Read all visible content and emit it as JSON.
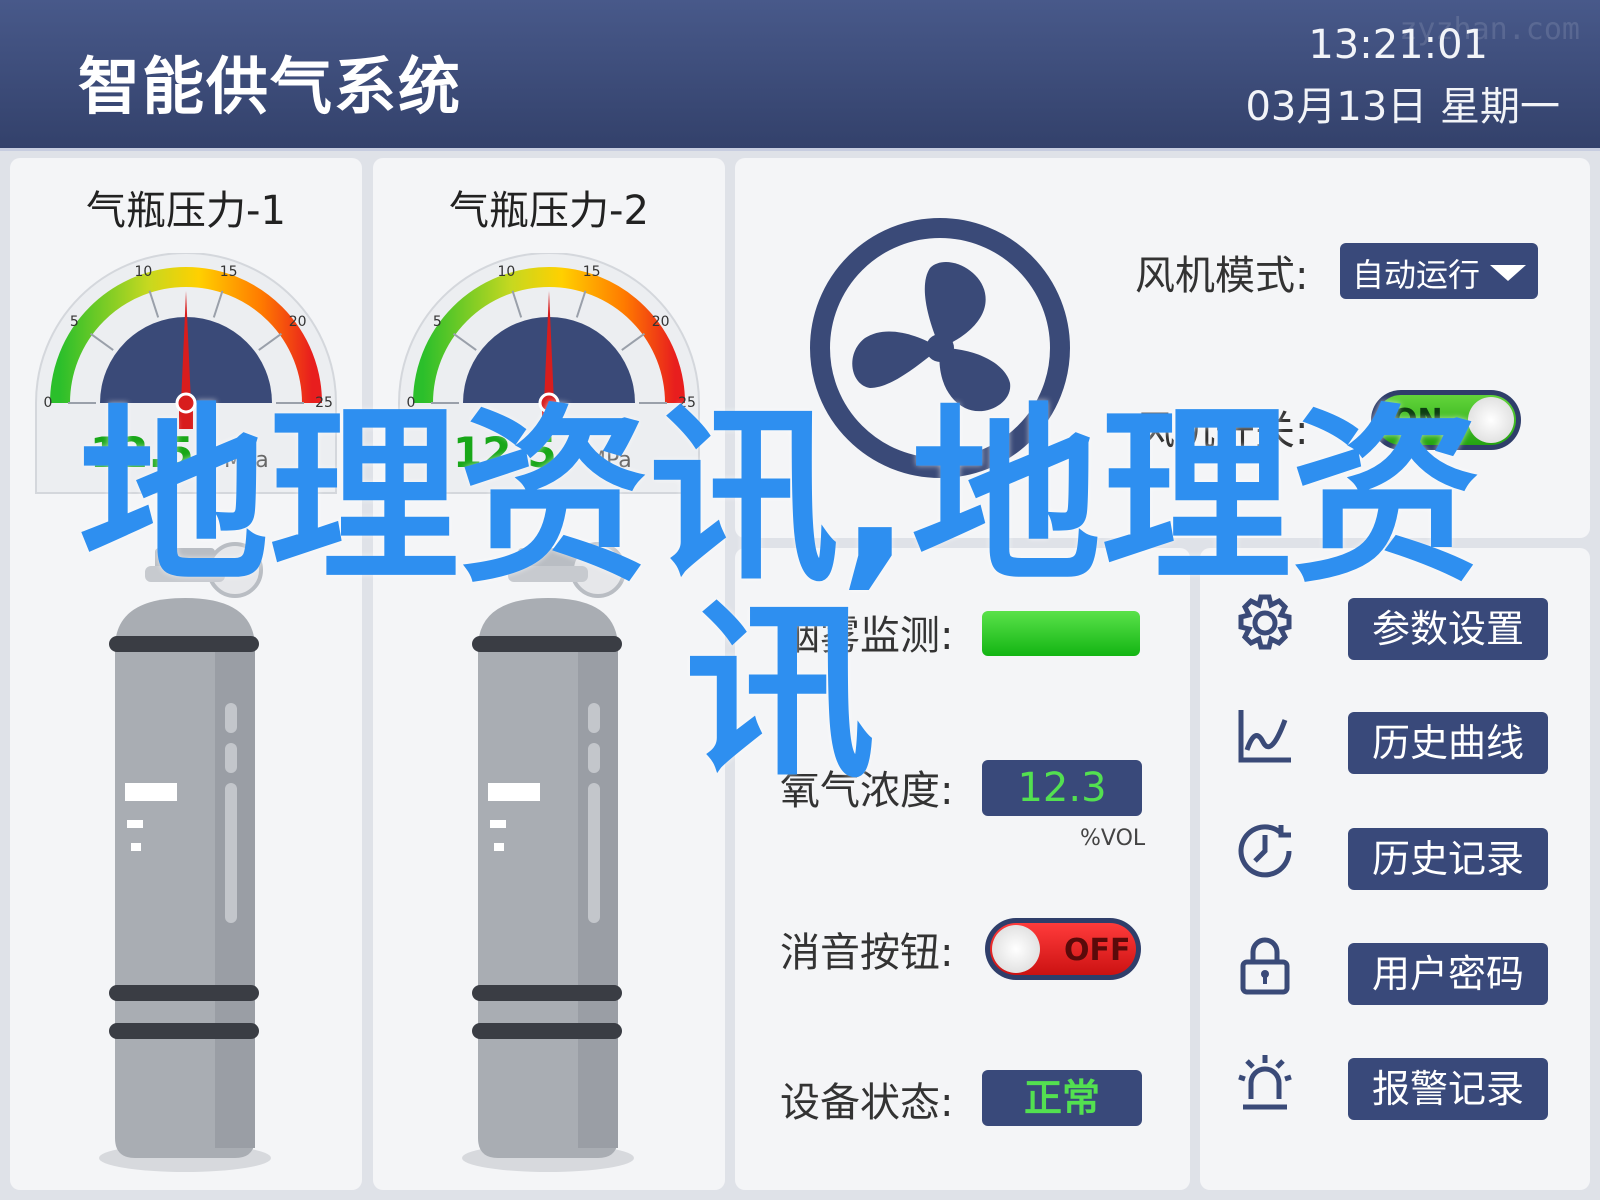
{
  "header": {
    "title": "智能供气系统",
    "time": "13:21:01",
    "date": "03月13日  星期一",
    "watermark": "zyzhan.com"
  },
  "cylinders": [
    {
      "title": "气瓶压力-1",
      "reading": "12.5",
      "unit": "MPa",
      "gauge_value": 12.5,
      "gauge_ticks": [
        "0",
        "5",
        "10",
        "15",
        "20",
        "25"
      ]
    },
    {
      "title": "气瓶压力-2",
      "reading": "12.5",
      "unit": "MPa",
      "gauge_value": 12.5,
      "gauge_ticks": [
        "0",
        "5",
        "10",
        "15",
        "20",
        "25"
      ]
    }
  ],
  "fan": {
    "icon": "fan-icon",
    "mode_label": "风机模式:",
    "mode_value": "自动运行",
    "switch_label": "风机开关:",
    "switch_value": "ON"
  },
  "status": {
    "smoke_label": "烟雾监测:",
    "o2_label": "氧气浓度:",
    "o2_value": "12.3",
    "o2_unit": "%VOL",
    "mute_label": "消音按钮:",
    "mute_value": "OFF",
    "device_label": "设备状态:",
    "device_value": "正常"
  },
  "menu": [
    {
      "icon": "gear-icon",
      "label": "参数设置"
    },
    {
      "icon": "chart-icon",
      "label": "历史曲线"
    },
    {
      "icon": "clock-icon",
      "label": "历史记录"
    },
    {
      "icon": "lock-icon",
      "label": "用户密码"
    },
    {
      "icon": "alarm-icon",
      "label": "报警记录"
    }
  ],
  "overlay_text": "地理资讯,地理资讯",
  "colors": {
    "header": "#3b4a78",
    "button": "#39497a",
    "ok_green": "#13b513",
    "alarm_red": "#cc1212",
    "overlay_blue": "#2e8ff0"
  }
}
